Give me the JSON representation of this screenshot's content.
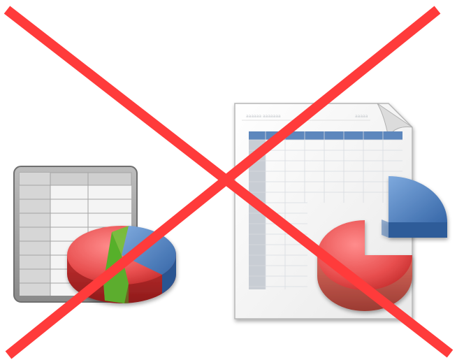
{
  "image": {
    "description_icons": [
      "spreadsheet-chart-icon",
      "spreadsheet-document-icon"
    ],
    "overlay": "red-cross-out",
    "colors": {
      "cross": "#ff3b3b",
      "pie_red": "#e84f4f",
      "pie_blue": "#4a7fc1",
      "pie_green": "#6cc43a",
      "table_header": "#5d87bd",
      "table_border": "#8a8a8a"
    }
  }
}
